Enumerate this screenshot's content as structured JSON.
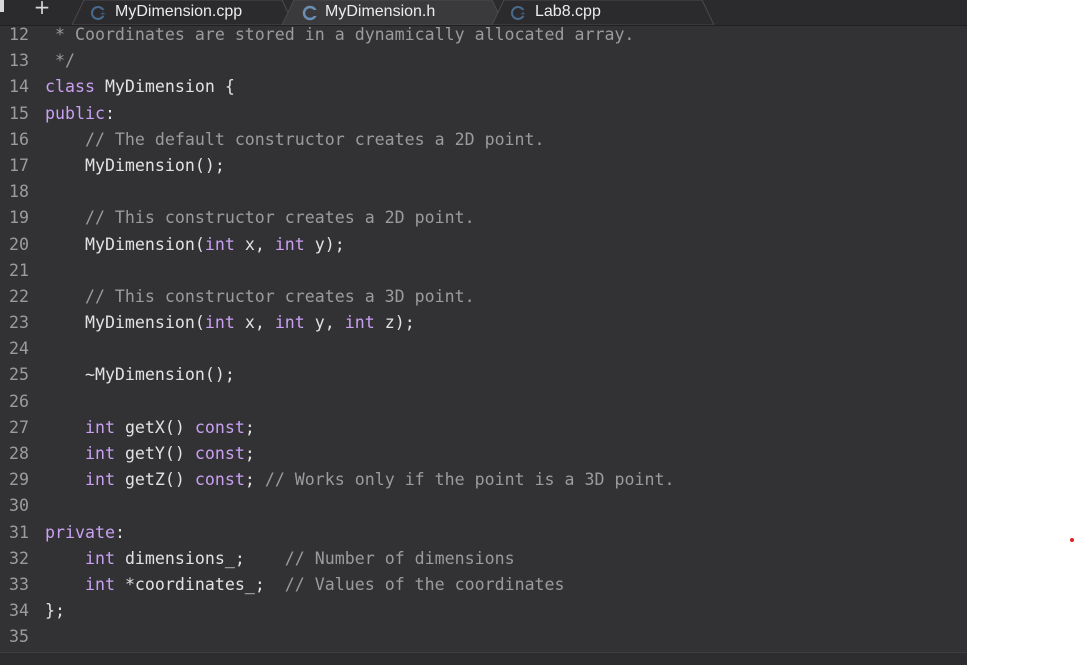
{
  "tabs": [
    {
      "label": "MyDimension.cpp",
      "icon": "cpp-file-icon",
      "active": false
    },
    {
      "label": "MyDimension.h",
      "icon": "c-header-file-icon",
      "active": true
    },
    {
      "label": "Lab8.cpp",
      "icon": "cpp-file-icon",
      "active": false
    }
  ],
  "new_tab_label": "+",
  "colors": {
    "editor_bg": "#323235",
    "keyword": "#c9a0f2",
    "comment": "#9b9b9e",
    "text": "#d8d8d8",
    "line_number": "#9c9c9c",
    "tab_active": "#3a3a3d",
    "tab_inactive": "#2b2b2e"
  },
  "code_lines": [
    {
      "n": "12",
      "tokens": [
        {
          "t": " * Coordinates are stored in a dynamically allocated array.",
          "c": "cm"
        }
      ]
    },
    {
      "n": "13",
      "tokens": [
        {
          "t": " */",
          "c": "cm"
        }
      ]
    },
    {
      "n": "14",
      "tokens": [
        {
          "t": "class",
          "c": "kw"
        },
        {
          "t": " MyDimension {",
          "c": "pl"
        }
      ]
    },
    {
      "n": "15",
      "tokens": [
        {
          "t": "public",
          "c": "kw"
        },
        {
          "t": ":",
          "c": "pl"
        }
      ]
    },
    {
      "n": "16",
      "tokens": [
        {
          "t": "    // The default constructor creates a 2D point.",
          "c": "cm"
        }
      ]
    },
    {
      "n": "17",
      "tokens": [
        {
          "t": "    MyDimension();",
          "c": "pl"
        }
      ]
    },
    {
      "n": "18",
      "tokens": []
    },
    {
      "n": "19",
      "tokens": [
        {
          "t": "    // This constructor creates a 2D point.",
          "c": "cm"
        }
      ]
    },
    {
      "n": "20",
      "tokens": [
        {
          "t": "    MyDimension(",
          "c": "pl"
        },
        {
          "t": "int",
          "c": "kw"
        },
        {
          "t": " x, ",
          "c": "pl"
        },
        {
          "t": "int",
          "c": "kw"
        },
        {
          "t": " y);",
          "c": "pl"
        }
      ]
    },
    {
      "n": "21",
      "tokens": []
    },
    {
      "n": "22",
      "tokens": [
        {
          "t": "    // This constructor creates a 3D point.",
          "c": "cm"
        }
      ]
    },
    {
      "n": "23",
      "tokens": [
        {
          "t": "    MyDimension(",
          "c": "pl"
        },
        {
          "t": "int",
          "c": "kw"
        },
        {
          "t": " x, ",
          "c": "pl"
        },
        {
          "t": "int",
          "c": "kw"
        },
        {
          "t": " y, ",
          "c": "pl"
        },
        {
          "t": "int",
          "c": "kw"
        },
        {
          "t": " z);",
          "c": "pl"
        }
      ]
    },
    {
      "n": "24",
      "tokens": []
    },
    {
      "n": "25",
      "tokens": [
        {
          "t": "    ~MyDimension();",
          "c": "pl"
        }
      ]
    },
    {
      "n": "26",
      "tokens": []
    },
    {
      "n": "27",
      "tokens": [
        {
          "t": "    ",
          "c": "pl"
        },
        {
          "t": "int",
          "c": "kw"
        },
        {
          "t": " getX() ",
          "c": "pl"
        },
        {
          "t": "const",
          "c": "kw"
        },
        {
          "t": ";",
          "c": "pl"
        }
      ]
    },
    {
      "n": "28",
      "tokens": [
        {
          "t": "    ",
          "c": "pl"
        },
        {
          "t": "int",
          "c": "kw"
        },
        {
          "t": " getY() ",
          "c": "pl"
        },
        {
          "t": "const",
          "c": "kw"
        },
        {
          "t": ";",
          "c": "pl"
        }
      ]
    },
    {
      "n": "29",
      "tokens": [
        {
          "t": "    ",
          "c": "pl"
        },
        {
          "t": "int",
          "c": "kw"
        },
        {
          "t": " getZ() ",
          "c": "pl"
        },
        {
          "t": "const",
          "c": "kw"
        },
        {
          "t": "; ",
          "c": "pl"
        },
        {
          "t": "// Works only if the point is a 3D point.",
          "c": "cm"
        }
      ]
    },
    {
      "n": "30",
      "tokens": []
    },
    {
      "n": "31",
      "tokens": [
        {
          "t": "private",
          "c": "kw"
        },
        {
          "t": ":",
          "c": "pl"
        }
      ]
    },
    {
      "n": "32",
      "tokens": [
        {
          "t": "    ",
          "c": "pl"
        },
        {
          "t": "int",
          "c": "kw"
        },
        {
          "t": " dimensions_;    ",
          "c": "pl"
        },
        {
          "t": "// Number of dimensions",
          "c": "cm"
        }
      ]
    },
    {
      "n": "33",
      "tokens": [
        {
          "t": "    ",
          "c": "pl"
        },
        {
          "t": "int",
          "c": "kw"
        },
        {
          "t": " *coordinates_;  ",
          "c": "pl"
        },
        {
          "t": "// Values of the coordinates",
          "c": "cm"
        }
      ]
    },
    {
      "n": "34",
      "tokens": [
        {
          "t": "};",
          "c": "pl"
        }
      ]
    },
    {
      "n": "35",
      "tokens": []
    }
  ]
}
